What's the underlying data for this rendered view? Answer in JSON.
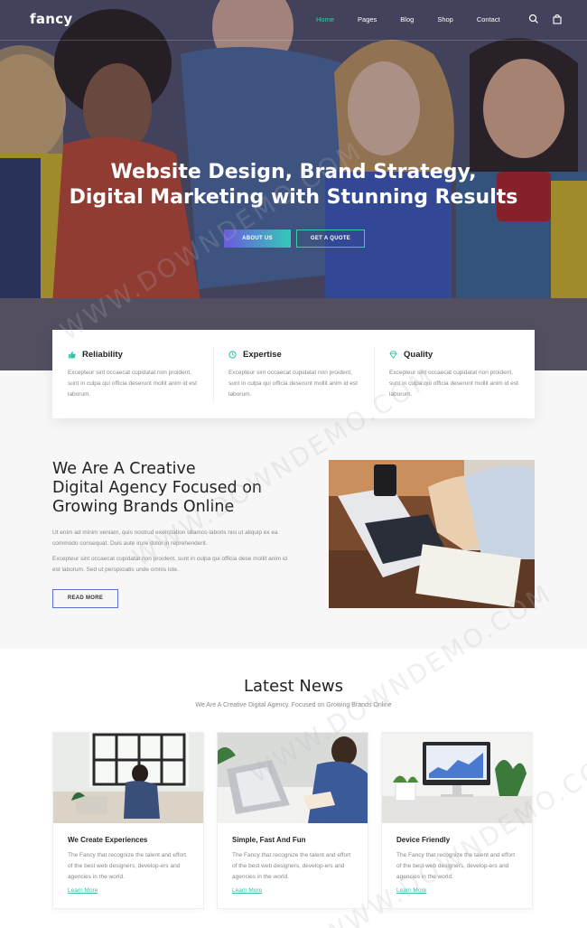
{
  "nav": {
    "logo": "fancy",
    "items": [
      {
        "label": "Home",
        "active": true
      },
      {
        "label": "Pages"
      },
      {
        "label": "Blog"
      },
      {
        "label": "Shop"
      },
      {
        "label": "Contact"
      }
    ],
    "icons": [
      "search-icon",
      "bag-icon"
    ]
  },
  "hero": {
    "title_line1": "Website Design, Brand Strategy,",
    "title_line2": "Digital Marketing with Stunning Results",
    "btn_about": "ABOUT US",
    "btn_quote": "GET A QUOTE"
  },
  "features": [
    {
      "icon": "thumbs-up-icon",
      "title": "Reliability",
      "text": "Excepteur sint occaecat cupidatat non proident, sunt in culpa qui officia deserunt mollit anim id est laborum."
    },
    {
      "icon": "clock-icon",
      "title": "Expertise",
      "text": "Excepteur sint occaecat cupidatat non proident, sunt in culpa qui officia deserunt mollit anim id est laborum."
    },
    {
      "icon": "diamond-icon",
      "title": "Quality",
      "text": "Excepteur sint occaecat cupidatat non proident, sunt in culpa qui officia deserunt mollit anim id est laborum."
    }
  ],
  "about": {
    "title_line1": "We Are A Creative",
    "title_line2": "Digital Agency Focused on",
    "title_line3": "Growing Brands Online",
    "p1": "Ut enim ad minim veniam, quis nostrud exercitation ullamco laboris nisi ut aliquip ex ea commodo consequat. Duis aute irure dolor in reprehenderit.",
    "p2": "Excepteur sint occaecat cupidatat non proident, sunt in culpa qui officia dese mollit anim id est laborum. Sed ut perspiciatis unde omnis iste.",
    "btn": "READ MORE"
  },
  "news": {
    "title": "Latest News",
    "subtitle": "We Are A Creative Digital Agency. Focused on Growing Brands Online",
    "cards": [
      {
        "title": "We Create Experiences",
        "text": "The Fancy that recognize the talent and effort of the best web designers, develop-ers and agencies in the world.",
        "link": "Learn More"
      },
      {
        "title": "Simple, Fast And Fun",
        "text": "The Fancy that recognize the talent and effort of the best web designers, develop-ers and agencies in the world.",
        "link": "Learn More"
      },
      {
        "title": "Device Friendly",
        "text": "The Fancy that recognize the talent and effort of the best web designers, develop-ers and agencies in the world.",
        "link": "Learn More"
      }
    ]
  },
  "watermark": "WWW.DOWNDEMO.COM",
  "colors": {
    "accent": "#34d1a6",
    "purple": "#6b5bdc"
  }
}
